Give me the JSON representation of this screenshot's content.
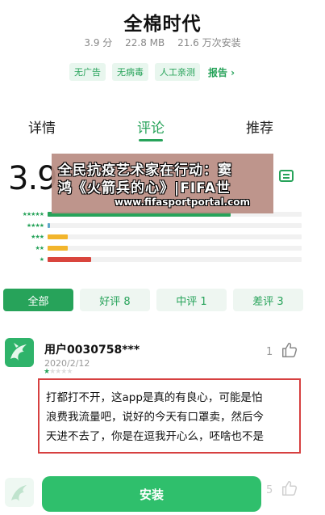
{
  "app": {
    "name": "全棉时代",
    "score": "3.9 分",
    "size": "22.8 MB",
    "installs": "21.6 万次安装"
  },
  "tags": [
    "无广告",
    "无病毒",
    "人工亲测"
  ],
  "report_label": "报告 ›",
  "tabs": [
    {
      "label": "详情",
      "active": false
    },
    {
      "label": "评论",
      "active": true
    },
    {
      "label": "推荐",
      "active": false
    }
  ],
  "rating": {
    "big_value": "3.9",
    "write_review_label": "评论",
    "distribution": [
      {
        "stars": "★★★★★",
        "fraction": 0.72,
        "color": "#27a35a"
      },
      {
        "stars": "★★★★",
        "fraction": 0.01,
        "color": "#5fa6c9"
      },
      {
        "stars": "★★★",
        "fraction": 0.08,
        "color": "#f2b52c"
      },
      {
        "stars": "★★",
        "fraction": 0.08,
        "color": "#f2b52c"
      },
      {
        "stars": "★",
        "fraction": 0.17,
        "color": "#d9453d"
      }
    ]
  },
  "watermark": {
    "line1": "全民抗疫艺术家在行动：窦",
    "line2": "鸿《火箭兵的心》|FIFA世",
    "line3": "www.fifasportportal.com"
  },
  "filters": [
    {
      "label": "全部",
      "active": true
    },
    {
      "label": "好评 8",
      "active": false
    },
    {
      "label": "中评 1",
      "active": false
    },
    {
      "label": "差评 3",
      "active": false
    }
  ],
  "review": {
    "user": "用户0030758***",
    "date": "2020/2/12",
    "rating": 1,
    "likes": "1",
    "content_lines": [
      "打都打不开，这app是真的有良心，可能是怕",
      "浪费我流量吧，说好的今天有口罩卖，然后今",
      "天进不去了，你是在逗我开心么，呸啥也不是"
    ]
  },
  "next_review": {
    "likes": "5"
  },
  "install_label": "安装",
  "colors": {
    "accent": "#27a35a",
    "highlight_border": "#d64040"
  }
}
